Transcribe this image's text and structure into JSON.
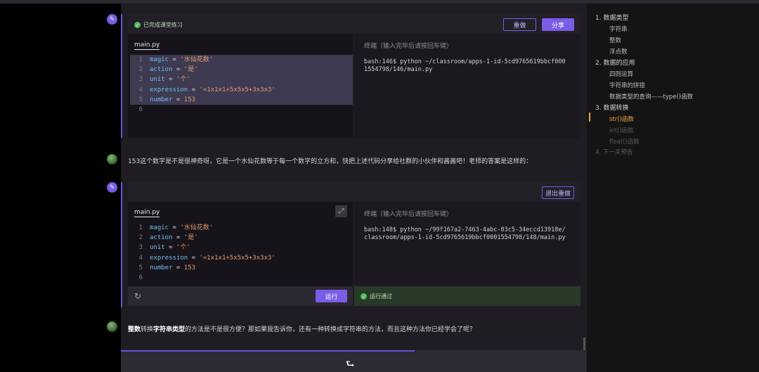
{
  "lesson": {
    "block1": {
      "status": "已完成课堂练习",
      "redo_label": "重做",
      "share_label": "分享",
      "file_tab": "main.py",
      "terminal_title": "终端（输入完毕后请按回车键）",
      "terminal_lines": [
        "bash:146$ python ~/classroom/apps-1-id-5cd9765619bbcf000",
        "1554798/146/main.py"
      ]
    },
    "message1": "153这个数字是不是很神奇呀，它是一个水仙花数等于每一个数字的立方和，快把上述代码分享给社群的小伙伴和酱酱吧！老师的答案是这样的：",
    "block2": {
      "exit_redo_label": "退出重做",
      "file_tab": "main.py",
      "terminal_title": "终端（输入完毕后请按回车键）",
      "terminal_lines": [
        "bash:148$ python ~/99f167a2-7463-4abc-83c5-34eccd13918e/",
        "classroom/apps-1-id-5cd9765619bbcf0001554798/148/main.py"
      ],
      "run_label": "运行",
      "pass_label": "运行通过"
    },
    "message2": {
      "b1": "整数",
      "t1": "转换",
      "b2": "字符串类型",
      "t2": "的方法是不是很方便？那如果我告诉你，还有一种转换成字符串的方法，而且这种方法你已经学会了呢？"
    },
    "code": {
      "line_numbers": [
        "1",
        "2",
        "3",
        "4",
        "5",
        "6"
      ],
      "lines": [
        {
          "var": "magic",
          "eq": " = ",
          "val": "'水仙花数'"
        },
        {
          "var": "action",
          "eq": " = ",
          "val": "'是'"
        },
        {
          "var": "unit",
          "eq": " = ",
          "val": "'个'"
        },
        {
          "var": "expression",
          "eq": " = ",
          "val": "'=1x1x1+5x5x5+3x3x3'"
        },
        {
          "var": "number",
          "eq": " = ",
          "val": "153"
        }
      ]
    }
  },
  "toc": {
    "s1": "1. 数据类型",
    "s1_items": [
      "字符串",
      "整数",
      "浮点数"
    ],
    "s2": "2. 数据的应用",
    "s2_items": [
      "四则运算",
      "字符串的拼接",
      "数据类型的查询——type()函数"
    ],
    "s3": "3. 数据转换",
    "s3_items": [
      "str()函数",
      "int()函数",
      "float()函数"
    ],
    "s4": "4. 下一关预告"
  },
  "colors": {
    "accent": "#7b5ce6",
    "active": "#e8a24a",
    "success": "#4fb95a"
  },
  "icons": [
    "edit-icon",
    "check-icon",
    "expand-icon",
    "refresh-icon",
    "next-arrow-icon"
  ]
}
